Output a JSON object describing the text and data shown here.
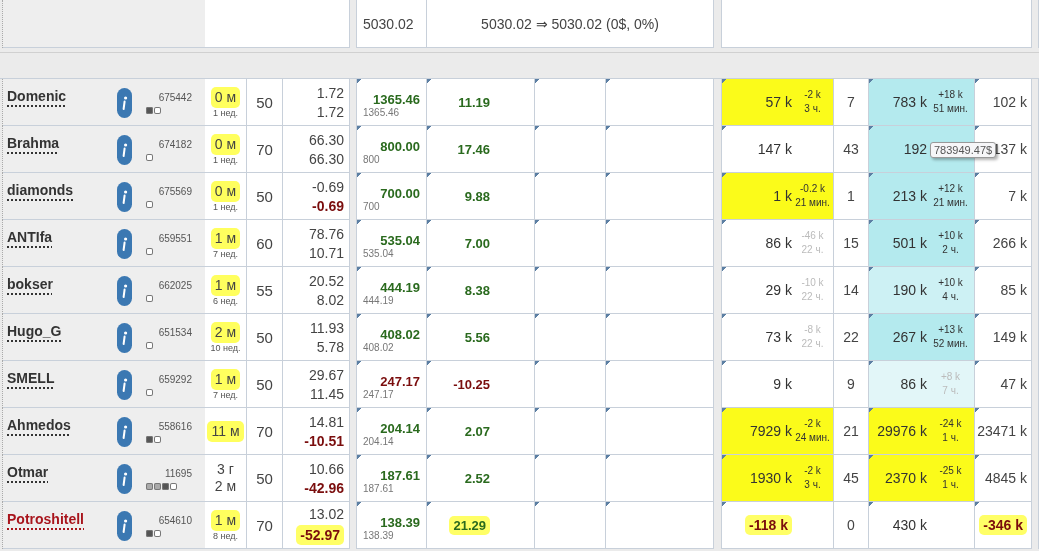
{
  "header": {
    "total": "5030.02",
    "summary": "5030.02 ⇒ 5030.02 (0$, 0%)"
  },
  "rows": [
    {
      "name": "Domenic",
      "flagged": false,
      "id": "675442",
      "dots": [
        {
          "color": "#555555"
        },
        {
          "color": "#ffffff"
        }
      ],
      "age": {
        "lines": [
          "0 м"
        ],
        "highlighted": true,
        "note": "1 нед."
      },
      "level": "50",
      "v1": "1.72",
      "v2": {
        "text": "1.72",
        "negative": false,
        "highlighted": false
      },
      "balance": {
        "text": "1365.46",
        "negative": false
      },
      "balance_sub": "1365.46",
      "change": {
        "text": "11.19",
        "negative": false,
        "highlighted": false
      },
      "a": {
        "value": {
          "text": "57 k",
          "negative": false,
          "highlighted": false
        },
        "delta": "-2 k",
        "ago": "3 ч.",
        "color": "#fbfb1a",
        "faded": false
      },
      "count": "7",
      "b": {
        "value": {
          "text": "783 k",
          "negative": false,
          "highlighted": false
        },
        "delta": "+18 k",
        "ago": "51 мин.",
        "color": "#b4eaee",
        "faded": false
      },
      "right": {
        "text": "102 k",
        "negative": false,
        "highlighted": false
      }
    },
    {
      "name": "Brahma",
      "flagged": false,
      "id": "674182",
      "dots": [
        {
          "color": "#ffffff"
        }
      ],
      "age": {
        "lines": [
          "0 м"
        ],
        "highlighted": true,
        "note": "1 нед."
      },
      "level": "70",
      "v1": "66.30",
      "v2": {
        "text": "66.30",
        "negative": false,
        "highlighted": false
      },
      "balance": {
        "text": "800.00",
        "negative": false
      },
      "balance_sub": "800",
      "change": {
        "text": "17.46",
        "negative": false,
        "highlighted": false
      },
      "a": {
        "value": {
          "text": "147 k",
          "negative": false,
          "highlighted": false
        }
      },
      "count": "43",
      "b": {
        "value": {
          "text": "192",
          "negative": false,
          "highlighted": false
        },
        "color": "#b4eaee",
        "tooltip": "783949.47$"
      },
      "right": {
        "text": "137 k",
        "negative": false,
        "highlighted": false
      }
    },
    {
      "name": "diamonds",
      "flagged": false,
      "id": "675569",
      "dots": [
        {
          "color": "#ffffff"
        }
      ],
      "age": {
        "lines": [
          "0 м"
        ],
        "highlighted": true,
        "note": "1 нед."
      },
      "level": "50",
      "v1": "-0.69",
      "v2": {
        "text": "-0.69",
        "negative": true,
        "highlighted": false
      },
      "balance": {
        "text": "700.00",
        "negative": false
      },
      "balance_sub": "700",
      "change": {
        "text": "9.88",
        "negative": false,
        "highlighted": false
      },
      "a": {
        "value": {
          "text": "1 k",
          "negative": false,
          "highlighted": false
        },
        "delta": "-0.2 k",
        "ago": "21 мин.",
        "color": "#fbfb1a",
        "faded": false
      },
      "count": "1",
      "b": {
        "value": {
          "text": "213 k",
          "negative": false,
          "highlighted": false
        },
        "delta": "+12 k",
        "ago": "21 мин.",
        "color": "#b4eaee",
        "faded": false
      },
      "right": {
        "text": "7 k",
        "negative": false,
        "highlighted": false
      }
    },
    {
      "name": "ANTIfa",
      "flagged": false,
      "id": "659551",
      "dots": [
        {
          "color": "#ffffff"
        }
      ],
      "age": {
        "lines": [
          "1 м"
        ],
        "highlighted": true,
        "note": "7 нед."
      },
      "level": "60",
      "v1": "78.76",
      "v2": {
        "text": "10.71",
        "negative": false,
        "highlighted": false
      },
      "balance": {
        "text": "535.04",
        "negative": false
      },
      "balance_sub": "535.04",
      "change": {
        "text": "7.00",
        "negative": false,
        "highlighted": false
      },
      "a": {
        "value": {
          "text": "86 k",
          "negative": false,
          "highlighted": false
        },
        "delta": "-46 k",
        "ago": "22 ч.",
        "faded": true
      },
      "count": "15",
      "b": {
        "value": {
          "text": "501 k",
          "negative": false,
          "highlighted": false
        },
        "delta": "+10 k",
        "ago": "2 ч.",
        "color": "#b4eaee",
        "faded": false
      },
      "right": {
        "text": "266 k",
        "negative": false,
        "highlighted": false
      }
    },
    {
      "name": "bokser",
      "flagged": false,
      "id": "662025",
      "dots": [
        {
          "color": "#ffffff"
        }
      ],
      "age": {
        "lines": [
          "1 м"
        ],
        "highlighted": true,
        "note": "6 нед."
      },
      "level": "55",
      "v1": "20.52",
      "v2": {
        "text": "8.02",
        "negative": false,
        "highlighted": false
      },
      "balance": {
        "text": "444.19",
        "negative": false
      },
      "balance_sub": "444.19",
      "change": {
        "text": "8.38",
        "negative": false,
        "highlighted": false
      },
      "a": {
        "value": {
          "text": "29 k",
          "negative": false,
          "highlighted": false
        },
        "delta": "-10 k",
        "ago": "22 ч.",
        "faded": true
      },
      "count": "14",
      "b": {
        "value": {
          "text": "190 k",
          "negative": false,
          "highlighted": false
        },
        "delta": "+10 k",
        "ago": "4 ч.",
        "color": "#cdf1f4",
        "faded": false
      },
      "right": {
        "text": "85 k",
        "negative": false,
        "highlighted": false
      }
    },
    {
      "name": "Hugo_G",
      "flagged": false,
      "id": "651534",
      "dots": [
        {
          "color": "#ffffff"
        }
      ],
      "age": {
        "lines": [
          "2 м"
        ],
        "highlighted": true,
        "note": "10 нед."
      },
      "level": "50",
      "v1": "11.93",
      "v2": {
        "text": "5.78",
        "negative": false,
        "highlighted": false
      },
      "balance": {
        "text": "408.02",
        "negative": false
      },
      "balance_sub": "408.02",
      "change": {
        "text": "5.56",
        "negative": false,
        "highlighted": false
      },
      "a": {
        "value": {
          "text": "73 k",
          "negative": false,
          "highlighted": false
        },
        "delta": "-8 k",
        "ago": "22 ч.",
        "faded": true
      },
      "count": "22",
      "b": {
        "value": {
          "text": "267 k",
          "negative": false,
          "highlighted": false
        },
        "delta": "+13 k",
        "ago": "52 мин.",
        "color": "#b4eaee",
        "faded": false
      },
      "right": {
        "text": "149 k",
        "negative": false,
        "highlighted": false
      }
    },
    {
      "name": "SMELL",
      "flagged": false,
      "id": "659292",
      "dots": [
        {
          "color": "#ffffff"
        }
      ],
      "age": {
        "lines": [
          "1 м"
        ],
        "highlighted": true,
        "note": "7 нед."
      },
      "level": "50",
      "v1": "29.67",
      "v2": {
        "text": "11.45",
        "negative": false,
        "highlighted": false
      },
      "balance": {
        "text": "247.17",
        "negative": true
      },
      "balance_sub": "247.17",
      "change": {
        "text": "-10.25",
        "negative": true,
        "highlighted": false
      },
      "a": {
        "value": {
          "text": "9 k",
          "negative": false,
          "highlighted": false
        }
      },
      "count": "9",
      "b": {
        "value": {
          "text": "86 k",
          "negative": false,
          "highlighted": false
        },
        "delta": "+8 k",
        "ago": "7 ч.",
        "color": "#e2f6f8",
        "faded": true
      },
      "right": {
        "text": "47 k",
        "negative": false,
        "highlighted": false
      }
    },
    {
      "name": "Ahmedos",
      "flagged": false,
      "id": "558616",
      "dots": [
        {
          "color": "#555555"
        },
        {
          "color": "#ffffff"
        }
      ],
      "age": {
        "lines": [
          "11 м"
        ],
        "highlighted": true
      },
      "level": "70",
      "v1": "14.81",
      "v2": {
        "text": "-10.51",
        "negative": true,
        "highlighted": false
      },
      "balance": {
        "text": "204.14",
        "negative": false
      },
      "balance_sub": "204.14",
      "change": {
        "text": "2.07",
        "negative": false,
        "highlighted": false
      },
      "a": {
        "value": {
          "text": "7929 k",
          "negative": false,
          "highlighted": false
        },
        "delta": "-2 k",
        "ago": "24 мин.",
        "color": "#fbfb1a",
        "faded": false
      },
      "count": "21",
      "b": {
        "value": {
          "text": "29976 k",
          "negative": false,
          "highlighted": false
        },
        "delta": "-24 k",
        "ago": "1 ч.",
        "color": "#fbfb1a",
        "faded": false
      },
      "right": {
        "text": "23471 k",
        "negative": false,
        "highlighted": false
      }
    },
    {
      "name": "Otmar",
      "flagged": false,
      "id": "11695",
      "dots": [
        {
          "color": "#aaaaaa"
        },
        {
          "color": "#aaaaaa"
        },
        {
          "color": "#555555"
        },
        {
          "color": "#ffffff"
        }
      ],
      "age": {
        "lines": [
          "3 г",
          "2 м"
        ],
        "highlighted": false
      },
      "level": "50",
      "v1": "10.66",
      "v2": {
        "text": "-42.96",
        "negative": true,
        "highlighted": false
      },
      "balance": {
        "text": "187.61",
        "negative": false
      },
      "balance_sub": "187.61",
      "change": {
        "text": "2.52",
        "negative": false,
        "highlighted": false
      },
      "a": {
        "value": {
          "text": "1930 k",
          "negative": false,
          "highlighted": false
        },
        "delta": "-2 k",
        "ago": "3 ч.",
        "color": "#fbfb1a",
        "faded": false
      },
      "count": "45",
      "b": {
        "value": {
          "text": "2370 k",
          "negative": false,
          "highlighted": false
        },
        "delta": "-25 k",
        "ago": "1 ч.",
        "color": "#fbfb1a",
        "faded": false
      },
      "right": {
        "text": "4845 k",
        "negative": false,
        "highlighted": false
      }
    },
    {
      "name": "Potroshitell",
      "flagged": true,
      "id": "654610",
      "dots": [
        {
          "color": "#555555"
        },
        {
          "color": "#ffffff"
        }
      ],
      "age": {
        "lines": [
          "1 м"
        ],
        "highlighted": true,
        "note": "8 нед."
      },
      "level": "70",
      "v1": "13.02",
      "v2": {
        "text": "-52.97",
        "negative": true,
        "highlighted": true
      },
      "balance": {
        "text": "138.39",
        "negative": false
      },
      "balance_sub": "138.39",
      "change": {
        "text": "21.29",
        "negative": false,
        "highlighted": true
      },
      "a": {
        "value": {
          "text": "-118 k",
          "negative": true,
          "highlighted": true
        }
      },
      "count": "0",
      "b": {
        "value": {
          "text": "430 k",
          "negative": false,
          "highlighted": false
        }
      },
      "right": {
        "text": "-346 k",
        "negative": true,
        "highlighted": true
      }
    }
  ]
}
